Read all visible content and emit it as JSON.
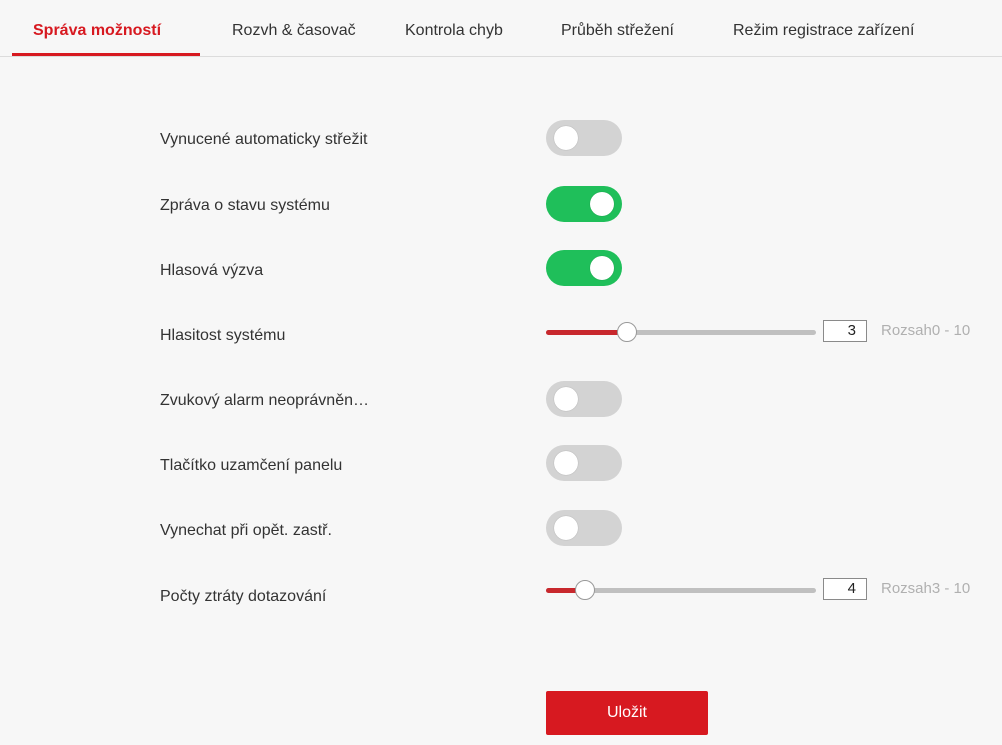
{
  "tabs": [
    {
      "label": "Správa možností",
      "active": true
    },
    {
      "label": "Rozvh & časovač",
      "active": false
    },
    {
      "label": "Kontrola chyb",
      "active": false
    },
    {
      "label": "Průběh střežení",
      "active": false
    },
    {
      "label": "Režim registrace zařízení",
      "active": false
    }
  ],
  "settings": {
    "forced_auto_arm": {
      "label": "Vynucené automaticky střežit",
      "enabled": false
    },
    "system_status_report": {
      "label": "Zpráva o stavu systému",
      "enabled": true
    },
    "voice_prompt": {
      "label": "Hlasová výzva",
      "enabled": true
    },
    "system_volume": {
      "label": "Hlasitost systému",
      "value": "3",
      "min": 0,
      "max": 10,
      "range_hint": "Rozsah0 - 10"
    },
    "tamper_audible_alarm": {
      "label": "Zvukový alarm neoprávněn…",
      "enabled": false
    },
    "panel_lock_button": {
      "label": "Tlačítko uzamčení panelu",
      "enabled": false
    },
    "bypass_on_rearm": {
      "label": "Vynechat při opět. zastř.",
      "enabled": false
    },
    "polling_loss_count": {
      "label": "Počty ztráty dotazování",
      "value": "4",
      "min": 3,
      "max": 10,
      "range_hint": "Rozsah3 - 10"
    }
  },
  "save_button": {
    "label": "Uložit"
  },
  "colors": {
    "accent_red": "#d71920",
    "toggle_on": "#1fbf5a",
    "toggle_off": "#d3d3d3",
    "slider_fill": "#c8282d"
  }
}
